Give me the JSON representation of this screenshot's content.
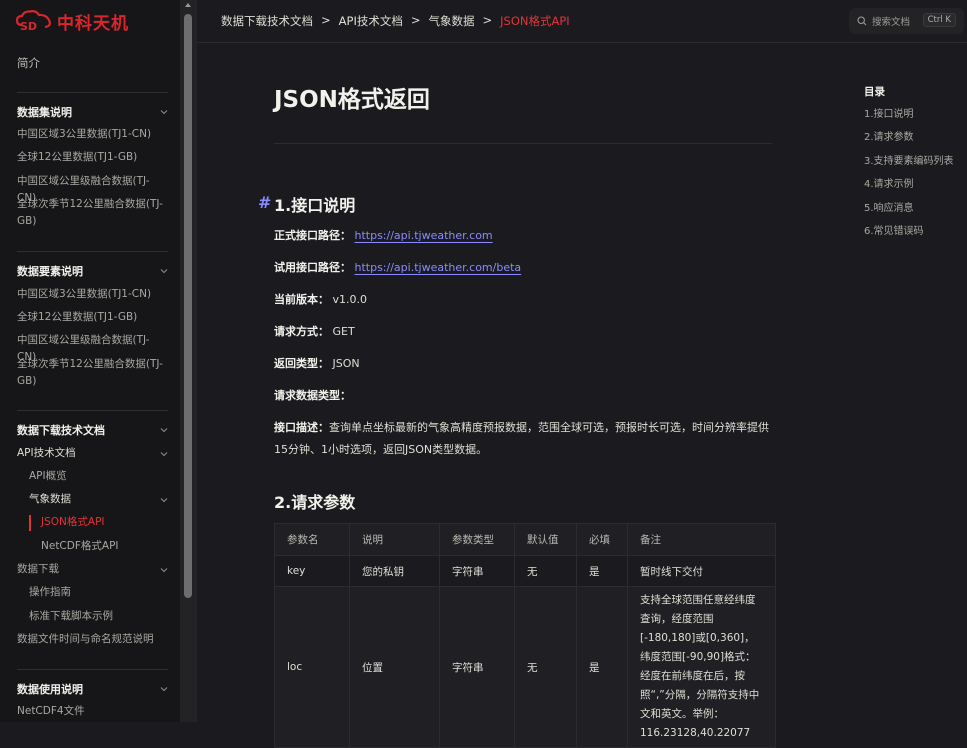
{
  "brand": {
    "name": "中科天机",
    "logo_mark": "SD",
    "logo_color": "#d9262c"
  },
  "sidebar": {
    "intro": "简介",
    "sections": [
      {
        "title": "数据集说明",
        "items": [
          "中国区域3公里数据(TJ1-CN)",
          "全球12公里数据(TJ1-GB)",
          "中国区域公里级融合数据(TJ-CN)",
          "全球次季节12公里融合数据(TJ-GB)"
        ]
      },
      {
        "title": "数据要素说明",
        "items": [
          "中国区域3公里数据(TJ1-CN)",
          "全球12公里数据(TJ1-GB)",
          "中国区域公里级融合数据(TJ-CN)",
          "全球次季节12公里融合数据(TJ-GB)"
        ]
      },
      {
        "title": "数据下载技术文档",
        "items": {
          "api_docs": "API技术文档",
          "api_overview": "API概览",
          "weather_data": "气象数据",
          "json_api": "JSON格式API",
          "netcdf_api": "NetCDF格式API",
          "data_download": "数据下载",
          "guide": "操作指南",
          "scripts": "标准下载脚本示例",
          "naming": "数据文件时间与命名规范说明"
        }
      },
      {
        "title": "数据使用说明",
        "items": [
          "NetCDF4文件"
        ]
      }
    ]
  },
  "breadcrumb": [
    "数据下载技术文档",
    "API技术文档",
    "气象数据",
    "JSON格式API"
  ],
  "breadcrumb_sep": ">",
  "search": {
    "placeholder": "搜索文档",
    "shortcut": "Ctrl K"
  },
  "page": {
    "title": "JSON格式返回",
    "sec1": "1.接口说明",
    "hash": "#",
    "fields": {
      "prod_label": "正式接口路径：",
      "prod_url": "https://api.tjweather.com",
      "trial_label": "试用接口路径：",
      "trial_url": "https://api.tjweather.com/beta",
      "version_label": "当前版本：",
      "version": "v1.0.0",
      "method_label": "请求方式：",
      "method": "GET",
      "return_label": "返回类型：",
      "return": "JSON",
      "reqtype_label": "请求数据类型：",
      "desc_label": "接口描述：",
      "desc": "查询单点坐标最新的气象高精度预报数据，范围全球可选，预报时长可选，时间分辨率提供15分钟、1小时选项，返回JSON类型数据。"
    },
    "sec2": "2.请求参数",
    "table": {
      "headers": [
        "参数名",
        "说明",
        "参数类型",
        "默认值",
        "必填",
        "备注"
      ],
      "rows": [
        [
          "key",
          "您的私钥",
          "字符串",
          "无",
          "是",
          "暂时线下交付"
        ],
        [
          "loc",
          "位置",
          "字符串",
          "无",
          "是",
          "支持全球范围任意经纬度查询，经度范围[-180,180]或[0,360]，纬度范围[-90,90]格式：经度在前纬度在后，按照“,”分隔，分隔符支持中文和英文。举例：116.23128,40.22077"
        ]
      ]
    }
  },
  "toc": {
    "title": "目录",
    "items": [
      "1.接口说明",
      "2.请求参数",
      "3.支持要素编码列表",
      "4.请求示例",
      "5.响应消息",
      "6.常见错误码"
    ]
  },
  "colors": {
    "accent": "#e2333a",
    "link": "#8a8cff",
    "bg": "#1b1b1f"
  }
}
